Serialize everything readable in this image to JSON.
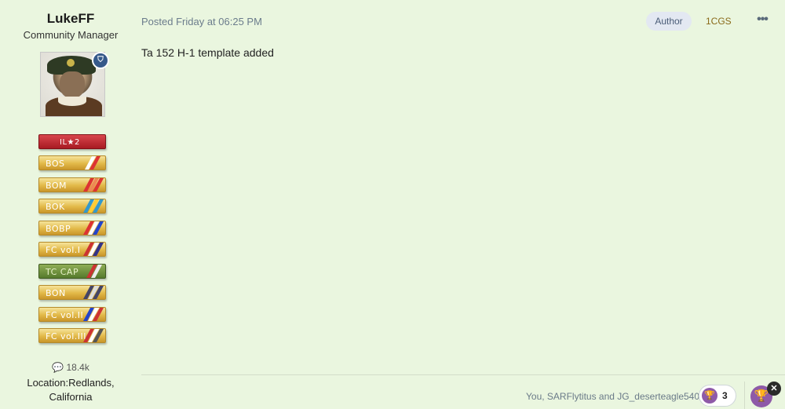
{
  "author": {
    "username": "LukeFF",
    "title": "Community Manager",
    "post_count": "18.4k",
    "location_label": "Location:",
    "location_line1": "Redlands,",
    "location_line2": "California"
  },
  "ribbons": [
    {
      "label": "IL★2",
      "style": "red"
    },
    {
      "label": "BOS",
      "style": "gold"
    },
    {
      "label": "BOM",
      "style": "gold"
    },
    {
      "label": "BOK",
      "style": "gold"
    },
    {
      "label": "BOBP",
      "style": "gold"
    },
    {
      "label": "FC vol.I",
      "style": "gold"
    },
    {
      "label": "TC CAP",
      "style": "green"
    },
    {
      "label": "BON",
      "style": "gold"
    },
    {
      "label": "FC vol.II",
      "style": "gold"
    },
    {
      "label": "FC vol.III",
      "style": "gold"
    }
  ],
  "post": {
    "meta": "Posted Friday at 06:25 PM",
    "author_badge": "Author",
    "group_tag": "1CGS",
    "more_icon": "ellipsis-icon",
    "body": "Ta 152 H-1 template added"
  },
  "reactions": {
    "reactors_text": "You, SARFlytitus and JG_deserteagle540",
    "count": "3",
    "icon": "trophy-icon",
    "accent_color": "#8e5aa8"
  },
  "colors": {
    "background": "#eaf6df",
    "moderator_badge": "#36598a"
  }
}
